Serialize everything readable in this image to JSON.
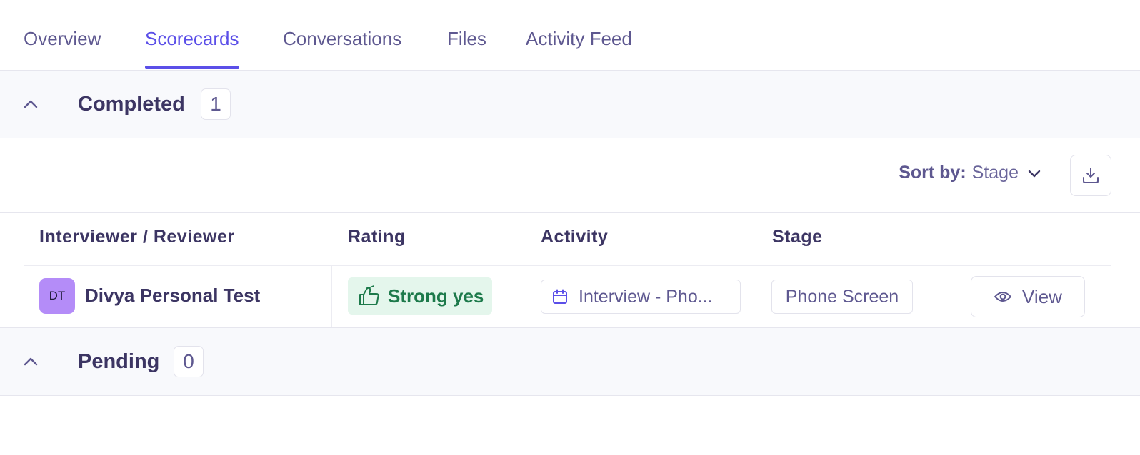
{
  "tabs": [
    {
      "label": "Overview",
      "active": false
    },
    {
      "label": "Scorecards",
      "active": true
    },
    {
      "label": "Conversations",
      "active": false
    },
    {
      "label": "Files",
      "active": false
    },
    {
      "label": "Activity Feed",
      "active": false
    }
  ],
  "completed": {
    "title": "Completed",
    "count": "1"
  },
  "toolbar": {
    "sort_label": "Sort by:",
    "sort_value": "Stage"
  },
  "table": {
    "columns": [
      "Interviewer / Reviewer",
      "Rating",
      "Activity",
      "Stage"
    ],
    "rows": [
      {
        "initials": "DT",
        "reviewer": "Divya Personal Test",
        "rating": "Strong yes",
        "activity": "Interview - Pho...",
        "stage": "Phone Screen",
        "action": "View"
      }
    ]
  },
  "pending": {
    "title": "Pending",
    "count": "0"
  },
  "colors": {
    "accent": "#5b4fe8",
    "avatar": "#b48cf8",
    "rating_bg": "#e4f6ec",
    "rating_text": "#1d7a4b",
    "section_bg": "#f8f9fc"
  },
  "icons": {
    "collapse": "chevron-up-icon",
    "sort": "chevron-down-icon",
    "download": "download-icon",
    "rating": "thumbs-up-icon",
    "activity": "calendar-icon",
    "view": "eye-icon"
  }
}
